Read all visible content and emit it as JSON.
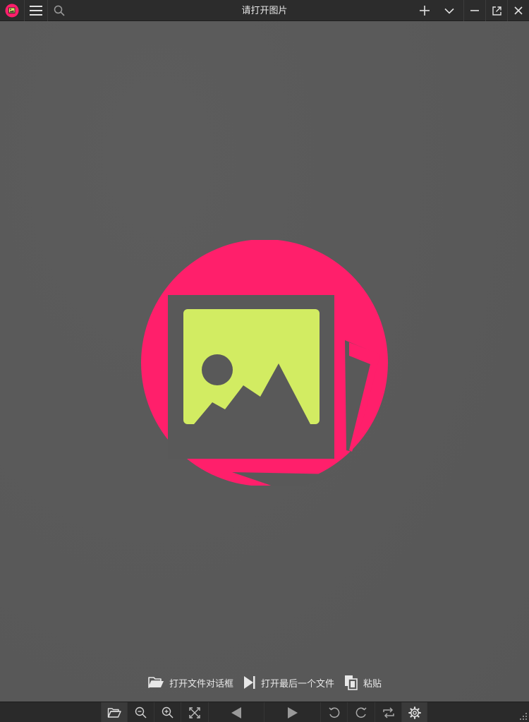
{
  "window": {
    "title": "请打开图片"
  },
  "titlebar": {
    "app_icon": "imageglass-logo-icon",
    "menu_icon": "hamburger-menu-icon",
    "search_icon": "search-icon",
    "new_window_icon": "plus-icon",
    "dropdown_icon": "chevron-down-icon",
    "minimize_icon": "minimize-icon",
    "popout_icon": "popout-icon",
    "close_icon": "close-icon"
  },
  "welcome": {
    "open_file_label": "打开文件对话框",
    "open_last_label": "打开最后一个文件",
    "paste_label": "粘贴"
  },
  "toolbar": {
    "buttons": [
      "folder-open-icon",
      "zoom-out-icon",
      "zoom-in-icon",
      "scale-to-fit-icon",
      "previous-icon",
      "next-icon",
      "rotate-left-icon",
      "rotate-right-icon",
      "flip-icon",
      "settings-icon"
    ]
  },
  "colors": {
    "accent_pink": "#ff1f6b",
    "accent_green": "#d2ec62",
    "titlebar_bg": "#2c2c2c",
    "viewer_bg": "#595959",
    "icon_fg": "#d9d9d9"
  }
}
